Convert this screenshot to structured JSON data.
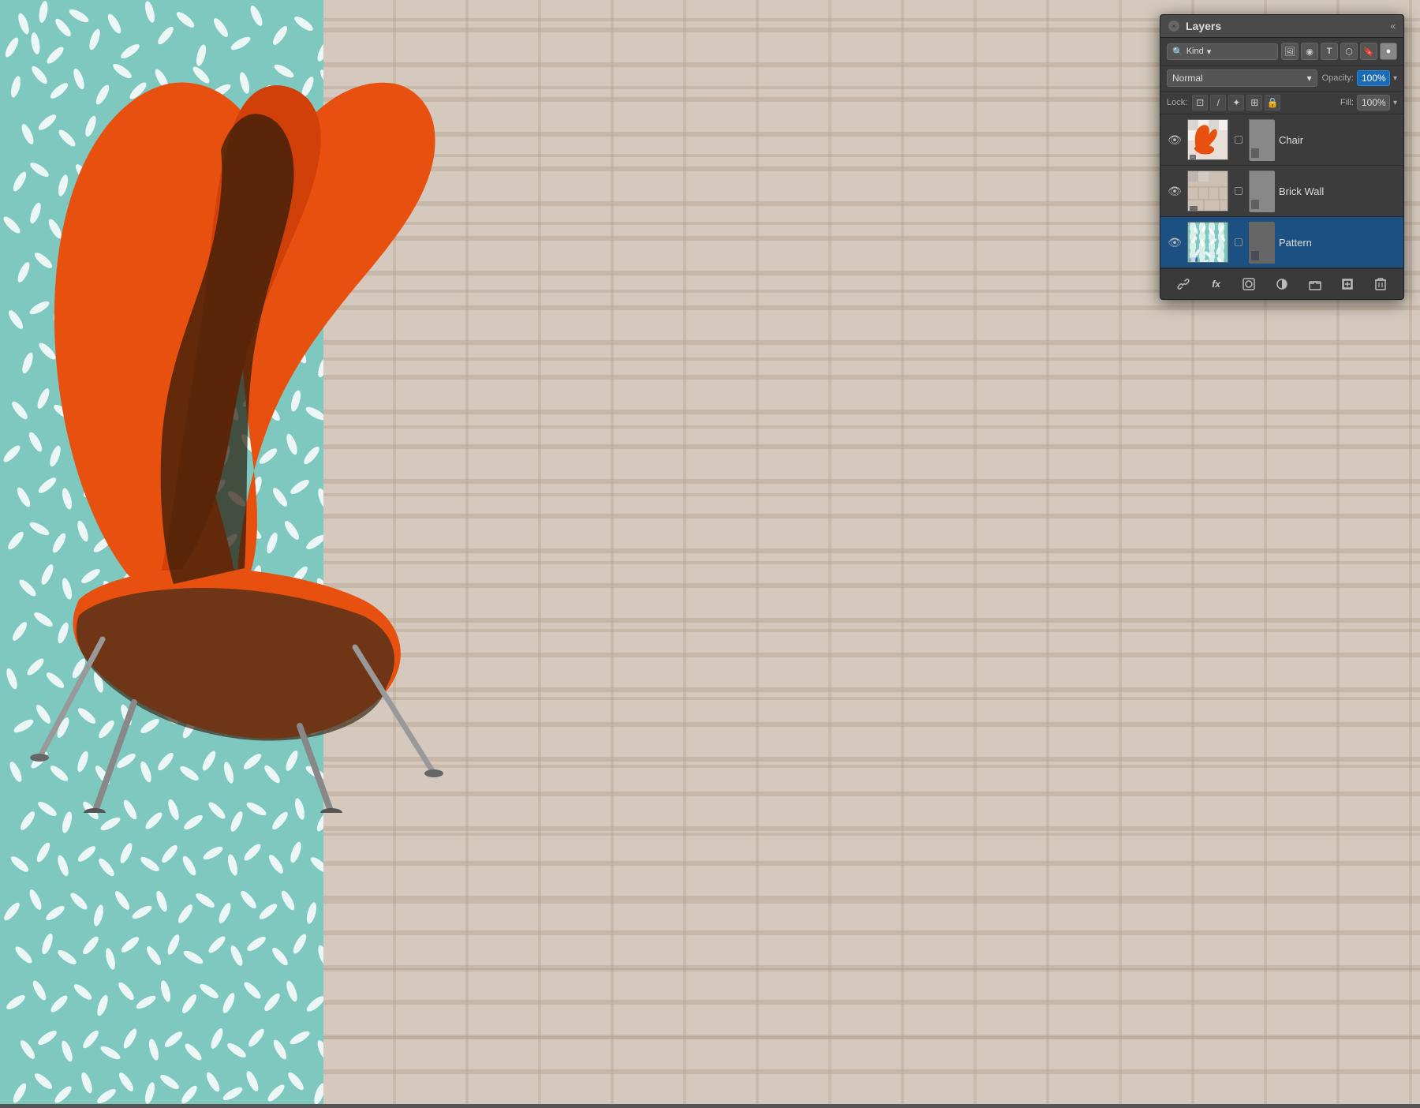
{
  "canvas": {
    "patternColor": "#7ec8c0",
    "brickColor": "#c8bdb0"
  },
  "layersPanel": {
    "title": "Layers",
    "closeLabel": "×",
    "collapseLabel": "«",
    "filter": {
      "kindLabel": "Kind",
      "dropdownArrow": "▾"
    },
    "filterIcons": [
      "🖼",
      "◉",
      "T",
      "⊡",
      "📌",
      "⊙"
    ],
    "blendMode": {
      "label": "Normal",
      "dropdownArrow": "▾"
    },
    "opacity": {
      "label": "Opacity:",
      "value": "100%",
      "arrow": "▾"
    },
    "lock": {
      "label": "Lock:",
      "buttons": [
        "⊡",
        "/",
        "✦",
        "⊞",
        "🔒"
      ]
    },
    "fill": {
      "label": "Fill:",
      "value": "100%",
      "arrow": "▾"
    },
    "layers": [
      {
        "name": "Chair",
        "visible": true,
        "active": false,
        "thumbType": "chair"
      },
      {
        "name": "Brick Wall",
        "visible": true,
        "active": false,
        "thumbType": "brick"
      },
      {
        "name": "Pattern",
        "visible": true,
        "active": true,
        "thumbType": "pattern"
      }
    ],
    "toolbar": {
      "link": "🔗",
      "fx": "fx",
      "circle": "◉",
      "mask": "⊙",
      "folder": "📁",
      "newLayer": "⊞",
      "delete": "🗑"
    }
  }
}
